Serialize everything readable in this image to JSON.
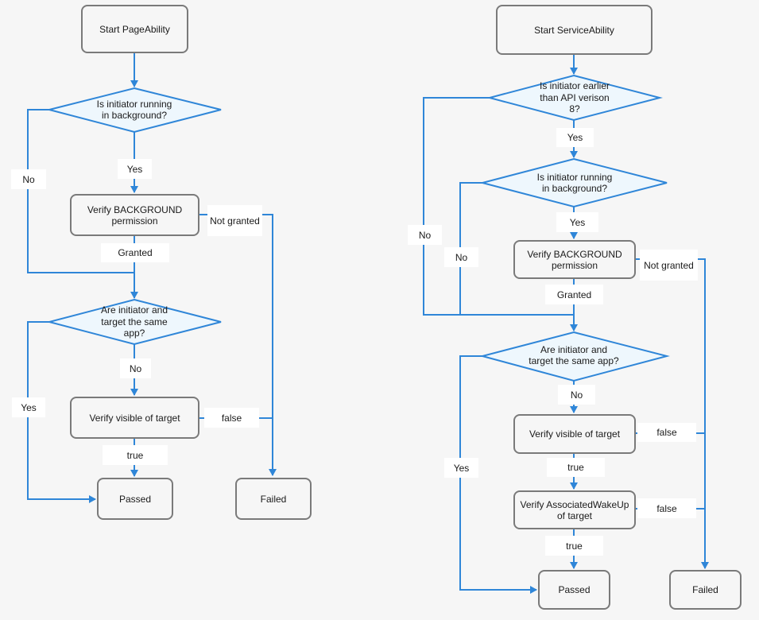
{
  "colors": {
    "background": "#f6f6f6",
    "connector": "#2f86d8",
    "decision_fill": "#eef7fd",
    "box_border": "#7a7a7a",
    "label_bg": "#ffffff"
  },
  "left": {
    "start": "Start PageAbility",
    "d1": "Is initiator running in background?",
    "d1_yes": "Yes",
    "d1_no": "No",
    "verify_bg": "Verify BACKGROUND permission",
    "granted": "Granted",
    "not_granted": "Not granted",
    "d2": "Are initiator and target the same app?",
    "d2_no": "No",
    "d2_yes": "Yes",
    "verify_visible": "Verify visible of target",
    "visible_true": "true",
    "visible_false": "false",
    "passed": "Passed",
    "failed": "Failed"
  },
  "right": {
    "start": "Start ServiceAbility",
    "d0": "Is initiator earlier than API verison 8?",
    "d0_yes": "Yes",
    "d0_no": "No",
    "d1": "Is initiator running in background?",
    "d1_yes": "Yes",
    "d1_no": "No",
    "verify_bg": "Verify BACKGROUND permission",
    "granted": "Granted",
    "not_granted": "Not granted",
    "d2": "Are initiator and target the same app?",
    "d2_no": "No",
    "d2_yes": "Yes",
    "verify_visible": "Verify visible of target",
    "visible_true": "true",
    "visible_false": "false",
    "verify_wakeup": "Verify AssociatedWakeUp of target",
    "wakeup_true": "true",
    "wakeup_false": "false",
    "passed": "Passed",
    "failed": "Failed"
  }
}
